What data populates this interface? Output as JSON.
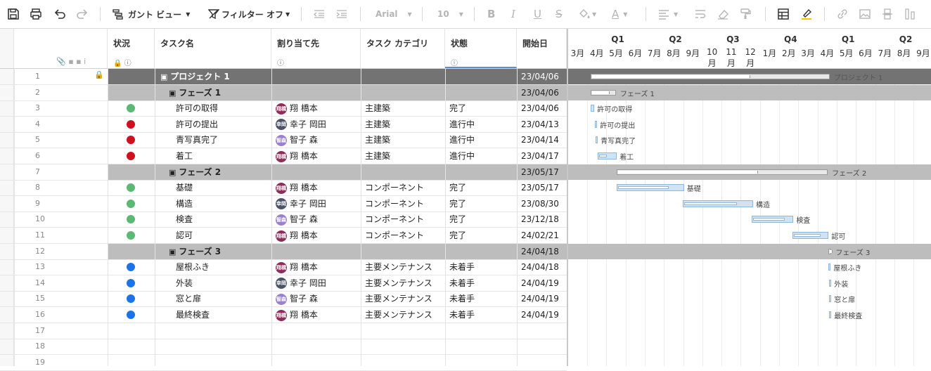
{
  "toolbar": {
    "view_label": "ガント ビュー",
    "filter_label": "フィルター オフ",
    "font_name": "Arial",
    "font_size": "10"
  },
  "columns": {
    "status": "状況",
    "task": "タスク名",
    "assignee": "割り当て先",
    "category": "タスク カテゴリ",
    "state": "状態",
    "start": "開始日"
  },
  "timeline": {
    "quarters": [
      "Q1",
      "Q2",
      "Q3",
      "Q4",
      "Q1",
      "Q2"
    ],
    "months": [
      "3月",
      "4月",
      "5月",
      "6月",
      "7月",
      "8月",
      "9月",
      "10月",
      "11月",
      "12月",
      "1月",
      "2月",
      "3月",
      "4月",
      "5月",
      "6月",
      "7月",
      "8月",
      "9月"
    ]
  },
  "rows": [
    {
      "num": "1",
      "type": "project",
      "task": "プロジェクト 1",
      "start": "23/04/06",
      "locked": true
    },
    {
      "num": "2",
      "type": "phase",
      "task": "フェーズ 1",
      "start": "23/04/06"
    },
    {
      "num": "3",
      "type": "task",
      "status": "green",
      "task": "許可の取得",
      "assignee": "翔 橋本",
      "avatar": "翔橋",
      "avatar_color": "#8b2c5a",
      "category": "主建築",
      "state": "完了",
      "start": "23/04/06"
    },
    {
      "num": "4",
      "type": "task",
      "status": "red",
      "task": "許可の提出",
      "assignee": "幸子 岡田",
      "avatar": "幸岡",
      "avatar_color": "#4a5368",
      "category": "主建築",
      "state": "進行中",
      "start": "23/04/13"
    },
    {
      "num": "5",
      "type": "task",
      "status": "red",
      "task": "青写真完了",
      "assignee": "智子 森",
      "avatar": "智森",
      "avatar_color": "#9b7fd0",
      "category": "主建築",
      "state": "進行中",
      "start": "23/04/14"
    },
    {
      "num": "6",
      "type": "task",
      "status": "red",
      "task": "着工",
      "assignee": "翔 橋本",
      "avatar": "翔橋",
      "avatar_color": "#8b2c5a",
      "category": "主建築",
      "state": "進行中",
      "start": "23/04/17"
    },
    {
      "num": "7",
      "type": "phase",
      "task": "フェーズ 2",
      "start": "23/05/17"
    },
    {
      "num": "8",
      "type": "task",
      "status": "green",
      "task": "基礎",
      "assignee": "翔 橋本",
      "avatar": "翔橋",
      "avatar_color": "#8b2c5a",
      "category": "コンポーネント",
      "state": "完了",
      "start": "23/05/17"
    },
    {
      "num": "9",
      "type": "task",
      "status": "green",
      "task": "構造",
      "assignee": "幸子 岡田",
      "avatar": "幸岡",
      "avatar_color": "#4a5368",
      "category": "コンポーネント",
      "state": "完了",
      "start": "23/08/30"
    },
    {
      "num": "10",
      "type": "task",
      "status": "green",
      "task": "検査",
      "assignee": "智子 森",
      "avatar": "智森",
      "avatar_color": "#9b7fd0",
      "category": "コンポーネント",
      "state": "完了",
      "start": "23/12/18"
    },
    {
      "num": "11",
      "type": "task",
      "status": "green",
      "task": "認可",
      "assignee": "翔 橋本",
      "avatar": "翔橋",
      "avatar_color": "#8b2c5a",
      "category": "コンポーネント",
      "state": "完了",
      "start": "24/02/21"
    },
    {
      "num": "12",
      "type": "phase",
      "task": "フェーズ 3",
      "start": "24/04/18"
    },
    {
      "num": "13",
      "type": "task",
      "status": "blue",
      "task": "屋根ふき",
      "assignee": "翔 橋本",
      "avatar": "翔橋",
      "avatar_color": "#8b2c5a",
      "category": "主要メンテナンス",
      "state": "未着手",
      "start": "24/04/18"
    },
    {
      "num": "14",
      "type": "task",
      "status": "blue",
      "task": "外装",
      "assignee": "幸子 岡田",
      "avatar": "幸岡",
      "avatar_color": "#4a5368",
      "category": "主要メンテナンス",
      "state": "未着手",
      "start": "24/04/19"
    },
    {
      "num": "15",
      "type": "task",
      "status": "blue",
      "task": "窓と扉",
      "assignee": "智子 森",
      "avatar": "智森",
      "avatar_color": "#9b7fd0",
      "category": "主要メンテナンス",
      "state": "未着手",
      "start": "24/04/19"
    },
    {
      "num": "16",
      "type": "task",
      "status": "blue",
      "task": "最終検査",
      "assignee": "翔 橋本",
      "avatar": "翔橋",
      "avatar_color": "#8b2c5a",
      "category": "主要メンテナンス",
      "state": "未着手",
      "start": "24/04/19"
    },
    {
      "num": "17",
      "type": "empty"
    },
    {
      "num": "18",
      "type": "empty"
    },
    {
      "num": "19",
      "type": "empty"
    }
  ],
  "colors": {
    "green": "#5bb974",
    "red": "#d0101e",
    "blue": "#1a73e8",
    "project_bg": "#737373",
    "phase_bg": "#bdbdbd"
  }
}
